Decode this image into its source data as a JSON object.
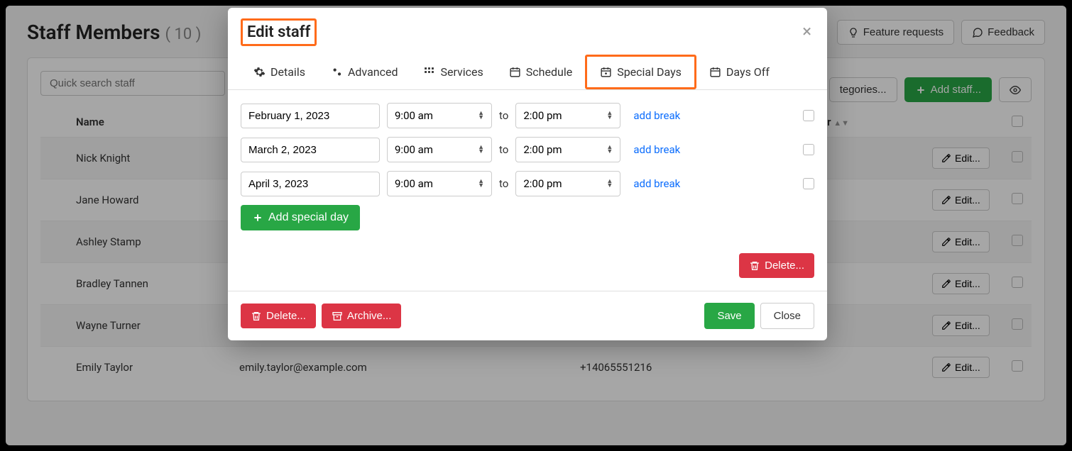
{
  "page": {
    "title": "Staff Members",
    "count": "( 10 )",
    "feature_requests": "Feature requests",
    "feedback": "Feedback",
    "categories": "tegories...",
    "add_staff": "Add staff...",
    "search_placeholder": "Quick search staff",
    "columns": {
      "name": "Name",
      "er": "er"
    },
    "edit_label": "Edit...",
    "staff": [
      {
        "color": "#c0392b",
        "name": "Nick Knight",
        "email": "",
        "phone": ""
      },
      {
        "color": "#1f5fb0",
        "name": "Jane Howard",
        "email": "",
        "phone": ""
      },
      {
        "color": "#5bc236",
        "name": "Ashley Stamp",
        "email": "",
        "phone": ""
      },
      {
        "color": "#c9c93a",
        "name": "Bradley Tannen",
        "email": "",
        "phone": ""
      },
      {
        "color": "#d68b1e",
        "name": "Wayne Turner",
        "email": "",
        "phone": ""
      },
      {
        "color": "#7b1fa2",
        "name": "Emily Taylor",
        "email": "emily.taylor@example.com",
        "phone": "+14065551216"
      }
    ]
  },
  "modal": {
    "title": "Edit staff",
    "tabs": {
      "details": "Details",
      "advanced": "Advanced",
      "services": "Services",
      "schedule": "Schedule",
      "special_days": "Special Days",
      "days_off": "Days Off"
    },
    "days": [
      {
        "date": "February 1, 2023",
        "from": "9:00 am",
        "to_text": "to",
        "to": "2:00 pm",
        "add_break": "add break"
      },
      {
        "date": "March 2, 2023",
        "from": "9:00 am",
        "to_text": "to",
        "to": "2:00 pm",
        "add_break": "add break"
      },
      {
        "date": "April 3, 2023",
        "from": "9:00 am",
        "to_text": "to",
        "to": "2:00 pm",
        "add_break": "add break"
      }
    ],
    "add_special_day": "Add special day",
    "delete_days": "Delete...",
    "footer": {
      "delete": "Delete...",
      "archive": "Archive...",
      "save": "Save",
      "close": "Close"
    }
  }
}
